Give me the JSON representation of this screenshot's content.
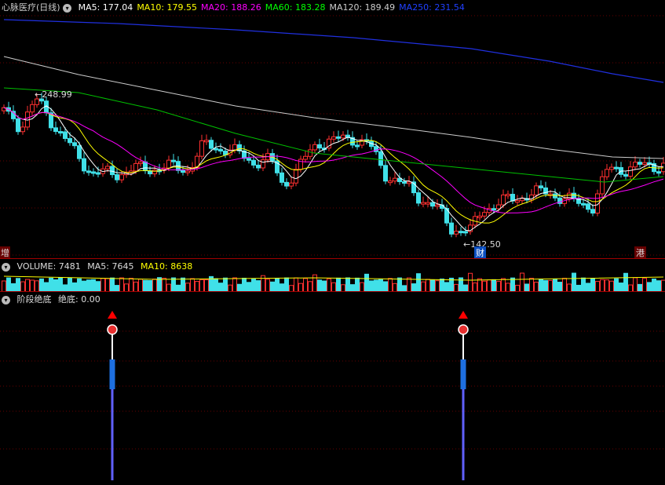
{
  "stock_name": "心脉医疗",
  "period": "(日线)",
  "ma_legend": [
    {
      "label": "MA5: 177.04",
      "color": "#ffffff"
    },
    {
      "label": "MA10: 179.55",
      "color": "#ffff00"
    },
    {
      "label": "MA20: 188.26",
      "color": "#ff00ff"
    },
    {
      "label": "MA60: 183.28",
      "color": "#00ff00"
    },
    {
      "label": "MA120: 189.49",
      "color": "#cccccc"
    },
    {
      "label": "MA250: 231.54",
      "color": "#2040ff"
    }
  ],
  "high_label": "248.99",
  "low_label": "142.50",
  "left_tag": "增",
  "right_tag": "港",
  "bottom_tag": "财",
  "volume_legend": {
    "volume": "VOLUME: 7481",
    "ma5": "MA5: 7645",
    "ma10": "MA10: 8638"
  },
  "indicator": {
    "name": "阶段绝底",
    "value": "绝底: 0.00"
  },
  "icons": [
    "circle-chevron-icon",
    "red-triangle-up-icon"
  ]
}
